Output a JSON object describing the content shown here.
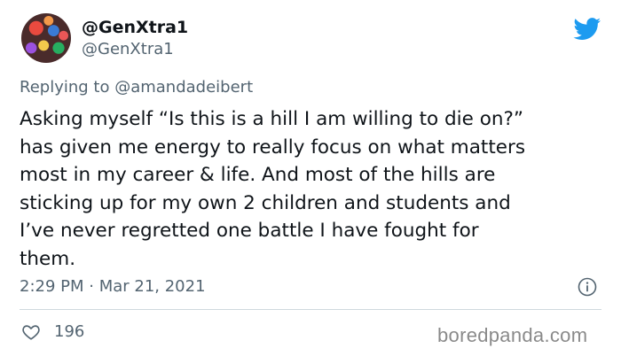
{
  "author": {
    "display_name": "@GenXtra1",
    "handle": "@GenXtra1"
  },
  "reply": {
    "prefix": "Replying to ",
    "mention": "@amandadeibert"
  },
  "tweet": {
    "text": "Asking myself “Is this is a hill I am willing to die on?”\nhas given me energy to really focus on what matters\nmost in my career & life. And most of the hills are\nsticking up for my own 2 children and students and\nI’ve never regretted one battle I have fought for\nthem."
  },
  "meta": {
    "timestamp": "2:29 PM · Mar 21, 2021"
  },
  "engagement": {
    "likes": "196"
  },
  "watermark": "boredpanda.com",
  "colors": {
    "twitter_blue": "#1d9bf0",
    "secondary_text": "#536471",
    "primary_text": "#0f1419"
  },
  "icons": {
    "brand": "twitter-bird-icon",
    "info": "info-icon",
    "like": "heart-icon"
  }
}
